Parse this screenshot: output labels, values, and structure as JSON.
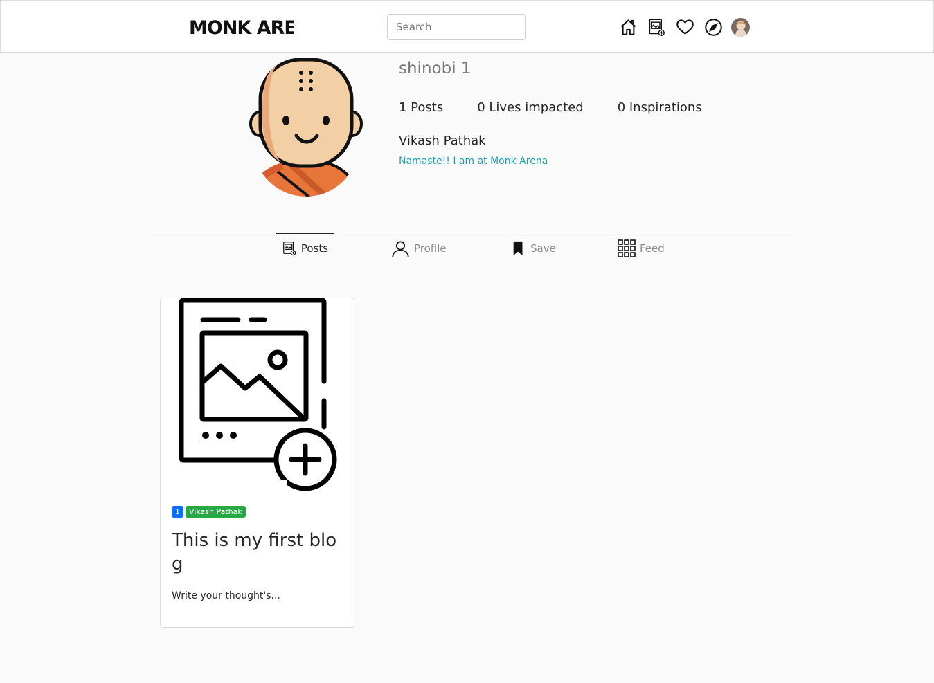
{
  "header": {
    "logo_text": "MONK ARENA",
    "search": {
      "placeholder": "Search"
    },
    "icons": [
      "home-icon",
      "new-post-icon",
      "heart-icon",
      "explore-icon",
      "user-avatar"
    ]
  },
  "profile": {
    "username": "shinobi 1",
    "stats": {
      "posts": "1 Posts",
      "lives": "0 Lives impacted",
      "inspirations": "0 Inspirations"
    },
    "full_name": "Vikash Pathak",
    "bio": "Namaste!! I am at Monk Arena"
  },
  "tabs": {
    "posts": "Posts",
    "profile": "Profile",
    "save": "Save",
    "feed": "Feed"
  },
  "posts": [
    {
      "badge_count": "1",
      "badge_author": "Vikash Pathak",
      "title": "This is my first blog",
      "excerpt": "Write your thought's..."
    }
  ],
  "colors": {
    "bio_link": "#1a9fb8",
    "badge_primary": "#0d6efd",
    "badge_success": "#28a745",
    "monk_skin": "#f2cfa4",
    "monk_robe": "#e8763a"
  }
}
